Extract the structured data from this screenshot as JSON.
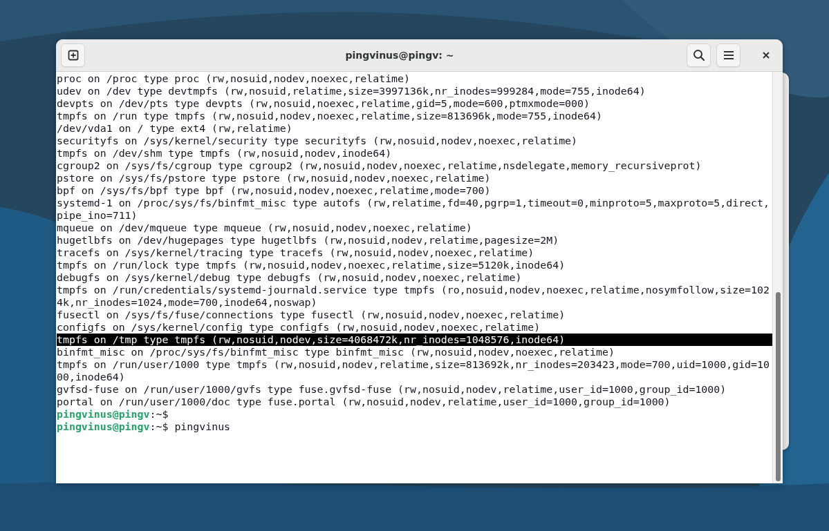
{
  "window": {
    "title": "pingvinus@pingv: ~"
  },
  "terminal": {
    "lines": [
      {
        "kind": "output",
        "selected": false,
        "text": "proc on /proc type proc (rw,nosuid,nodev,noexec,relatime)"
      },
      {
        "kind": "output",
        "selected": false,
        "text": "udev on /dev type devtmpfs (rw,nosuid,relatime,size=3997136k,nr_inodes=999284,mode=755,inode64)"
      },
      {
        "kind": "output",
        "selected": false,
        "text": "devpts on /dev/pts type devpts (rw,nosuid,noexec,relatime,gid=5,mode=600,ptmxmode=000)"
      },
      {
        "kind": "output",
        "selected": false,
        "text": "tmpfs on /run type tmpfs (rw,nosuid,nodev,noexec,relatime,size=813696k,mode=755,inode64)"
      },
      {
        "kind": "output",
        "selected": false,
        "text": "/dev/vda1 on / type ext4 (rw,relatime)"
      },
      {
        "kind": "output",
        "selected": false,
        "text": "securityfs on /sys/kernel/security type securityfs (rw,nosuid,nodev,noexec,relatime)"
      },
      {
        "kind": "output",
        "selected": false,
        "text": "tmpfs on /dev/shm type tmpfs (rw,nosuid,nodev,inode64)"
      },
      {
        "kind": "output",
        "selected": false,
        "text": "cgroup2 on /sys/fs/cgroup type cgroup2 (rw,nosuid,nodev,noexec,relatime,nsdelegate,memory_recursiveprot)"
      },
      {
        "kind": "output",
        "selected": false,
        "text": "pstore on /sys/fs/pstore type pstore (rw,nosuid,nodev,noexec,relatime)"
      },
      {
        "kind": "output",
        "selected": false,
        "text": "bpf on /sys/fs/bpf type bpf (rw,nosuid,nodev,noexec,relatime,mode=700)"
      },
      {
        "kind": "output",
        "selected": false,
        "text": "systemd-1 on /proc/sys/fs/binfmt_misc type autofs (rw,relatime,fd=40,pgrp=1,timeout=0,minproto=5,maxproto=5,direct,"
      },
      {
        "kind": "output",
        "selected": false,
        "text": "pipe_ino=711)"
      },
      {
        "kind": "output",
        "selected": false,
        "text": "mqueue on /dev/mqueue type mqueue (rw,nosuid,nodev,noexec,relatime)"
      },
      {
        "kind": "output",
        "selected": false,
        "text": "hugetlbfs on /dev/hugepages type hugetlbfs (rw,nosuid,nodev,relatime,pagesize=2M)"
      },
      {
        "kind": "output",
        "selected": false,
        "text": "tracefs on /sys/kernel/tracing type tracefs (rw,nosuid,nodev,noexec,relatime)"
      },
      {
        "kind": "output",
        "selected": false,
        "text": "tmpfs on /run/lock type tmpfs (rw,nosuid,nodev,noexec,relatime,size=5120k,inode64)"
      },
      {
        "kind": "output",
        "selected": false,
        "text": "debugfs on /sys/kernel/debug type debugfs (rw,nosuid,nodev,noexec,relatime)"
      },
      {
        "kind": "output",
        "selected": false,
        "text": "tmpfs on /run/credentials/systemd-journald.service type tmpfs (ro,nosuid,nodev,noexec,relatime,nosymfollow,size=102"
      },
      {
        "kind": "output",
        "selected": false,
        "text": "4k,nr_inodes=1024,mode=700,inode64,noswap)"
      },
      {
        "kind": "output",
        "selected": false,
        "text": "fusectl on /sys/fs/fuse/connections type fusectl (rw,nosuid,nodev,noexec,relatime)"
      },
      {
        "kind": "output",
        "selected": false,
        "text": "configfs on /sys/kernel/config type configfs (rw,nosuid,nodev,noexec,relatime)"
      },
      {
        "kind": "output",
        "selected": true,
        "text": "tmpfs on /tmp type tmpfs (rw,nosuid,nodev,size=4068472k,nr_inodes=1048576,inode64)"
      },
      {
        "kind": "output",
        "selected": false,
        "text": "binfmt_misc on /proc/sys/fs/binfmt_misc type binfmt_misc (rw,nosuid,nodev,noexec,relatime)"
      },
      {
        "kind": "output",
        "selected": false,
        "text": "tmpfs on /run/user/1000 type tmpfs (rw,nosuid,nodev,relatime,size=813692k,nr_inodes=203423,mode=700,uid=1000,gid=10"
      },
      {
        "kind": "output",
        "selected": false,
        "text": "00,inode64)"
      },
      {
        "kind": "output",
        "selected": false,
        "text": "gvfsd-fuse on /run/user/1000/gvfs type fuse.gvfsd-fuse (rw,nosuid,nodev,relatime,user_id=1000,group_id=1000)"
      },
      {
        "kind": "output",
        "selected": false,
        "text": "portal on /run/user/1000/doc type fuse.portal (rw,nosuid,nodev,relatime,user_id=1000,group_id=1000)"
      },
      {
        "kind": "prompt",
        "selected": false,
        "user_host": "pingvinus@pingv",
        "path": ":~$"
      },
      {
        "kind": "prompt",
        "selected": false,
        "user_host": "pingvinus@pingv",
        "path": ":~$",
        "command": "pingvinus"
      }
    ]
  }
}
